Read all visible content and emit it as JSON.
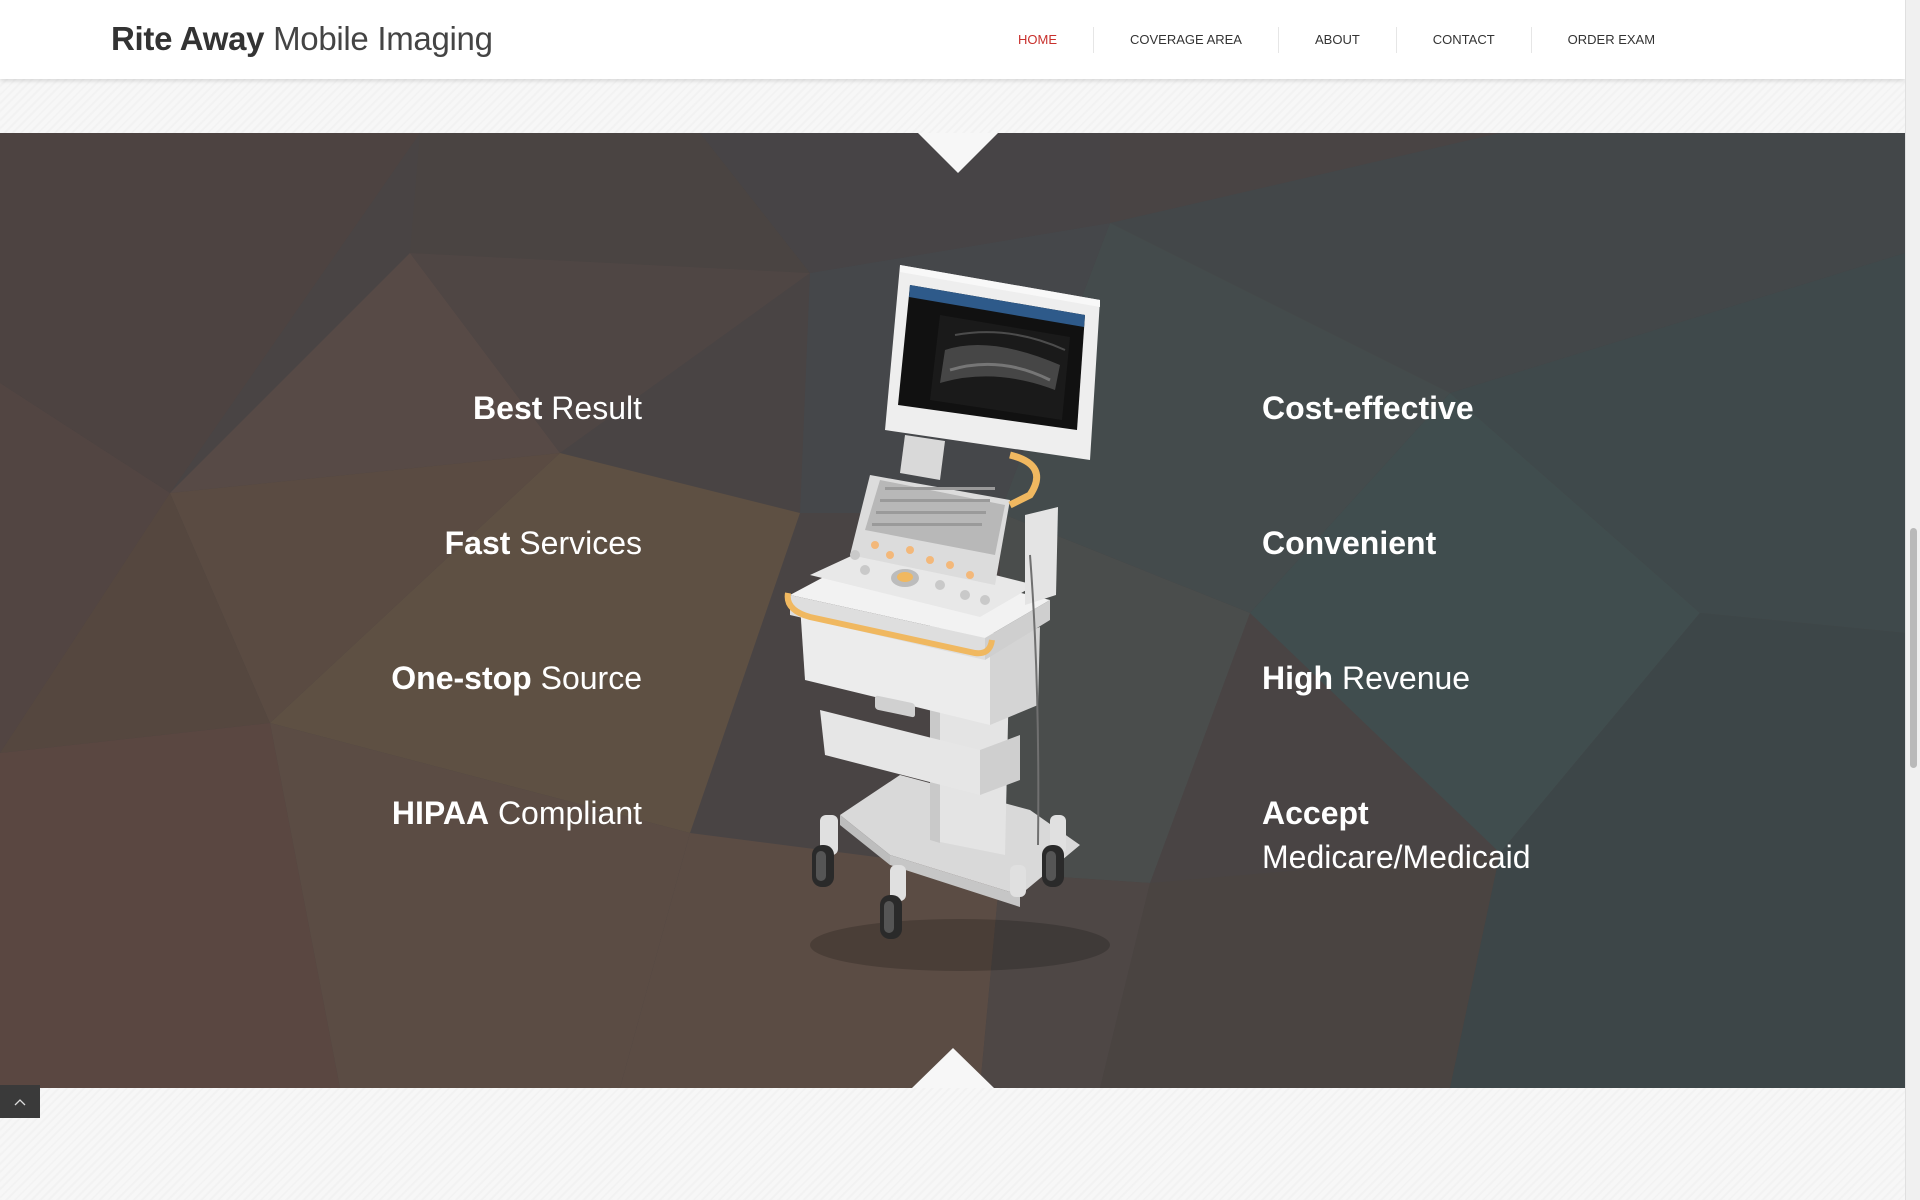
{
  "brand": {
    "bold": "Rite Away",
    "light": "Mobile Imaging"
  },
  "nav": {
    "items": [
      "HOME",
      "COVERAGE AREA",
      "ABOUT",
      "CONTACT",
      "ORDER EXAM"
    ],
    "active": "HOME"
  },
  "features": {
    "left": [
      {
        "bold": "Best",
        "light": "Result"
      },
      {
        "bold": "Fast",
        "light": "Services"
      },
      {
        "bold": "One-stop",
        "light": "Source"
      },
      {
        "bold": "HIPAA",
        "light": "Compliant"
      }
    ],
    "right": [
      {
        "bold": "Cost-effective",
        "light": ""
      },
      {
        "bold": "Convenient",
        "light": ""
      },
      {
        "bold": "High",
        "light": "Revenue"
      },
      {
        "bold": "Accept",
        "light": "Medicare/Medicaid"
      }
    ]
  },
  "colors": {
    "active_nav": "#c8302c",
    "band_base": "#4a4644"
  },
  "icons": {
    "back_to_top": "chevron-up-icon",
    "device": "ultrasound-cart-image"
  }
}
